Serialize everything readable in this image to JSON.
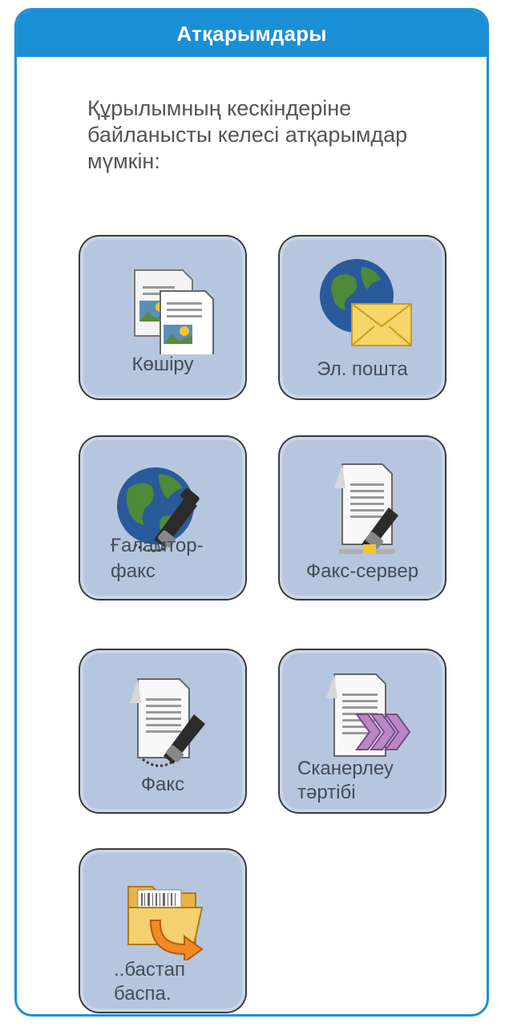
{
  "header": {
    "title": "Атқарымдары"
  },
  "intro": {
    "text": "Құрылымның кескіндеріне байланысты келесі атқарымдар мүмкін:"
  },
  "tiles": [
    {
      "label": "Көшіру",
      "icon": "copy-icon"
    },
    {
      "label": "Эл. пошта",
      "icon": "email-icon"
    },
    {
      "label_line1": "Ғаламтор-",
      "label_line2": "факс",
      "icon": "internet-fax-icon"
    },
    {
      "label": "Факс-сервер",
      "icon": "server-fax-icon"
    },
    {
      "label": "Факс",
      "icon": "fax-icon"
    },
    {
      "label_line1": "Сканерлеу",
      "label_line2": "тәртібі",
      "icon": "scan-workflow-icon"
    },
    {
      "label_line1": "..бастап",
      "label_line2": "баспа.",
      "icon": "print-from-folder-icon"
    }
  ],
  "colors": {
    "header_blue": "#1b8fd6",
    "tile_fill": "#b7c6df",
    "tile_border": "#3a3a3a"
  }
}
